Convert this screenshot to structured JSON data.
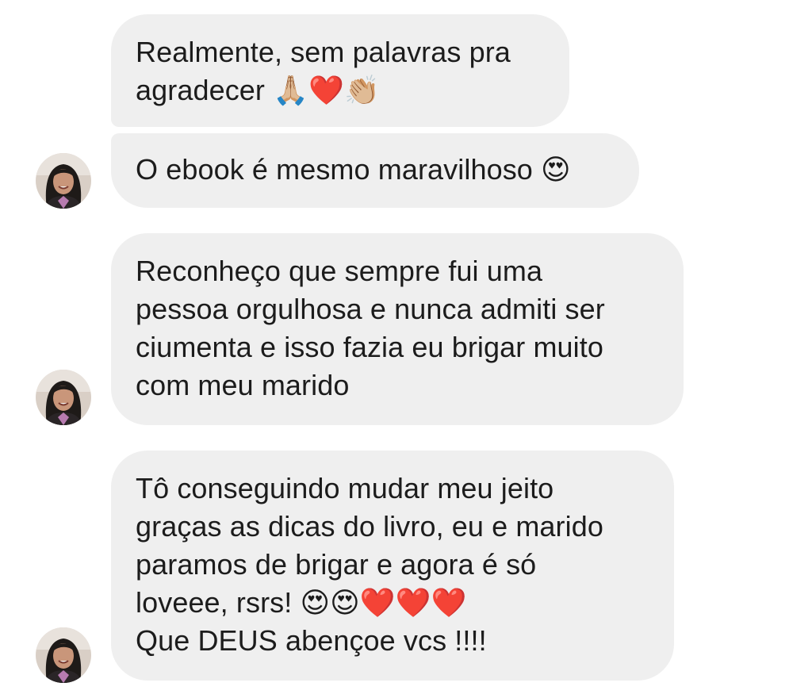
{
  "conversation": {
    "messages": [
      {
        "text": "Realmente, sem palavras pra\nagradecer 🙏🏼❤️👏🏼"
      },
      {
        "text": "O ebook é mesmo maravilhoso 😍"
      },
      {
        "text": "Reconheço que sempre fui uma\npessoa orgulhosa e nunca admiti ser\nciumenta e isso fazia eu brigar muito\ncom meu marido"
      },
      {
        "text": "Tô conseguindo mudar meu jeito\ngraças as dicas do livro, eu e marido\nparamos de brigar e agora é só\nloveee, rsrs! 😍😍❤️❤️❤️\nQue DEUS abençoe vcs !!!!"
      }
    ]
  },
  "colors": {
    "bubble_background": "#efefef",
    "text": "#1c1c1c",
    "page_background": "#ffffff"
  },
  "icons": {
    "avatar": "user-avatar-photo"
  }
}
